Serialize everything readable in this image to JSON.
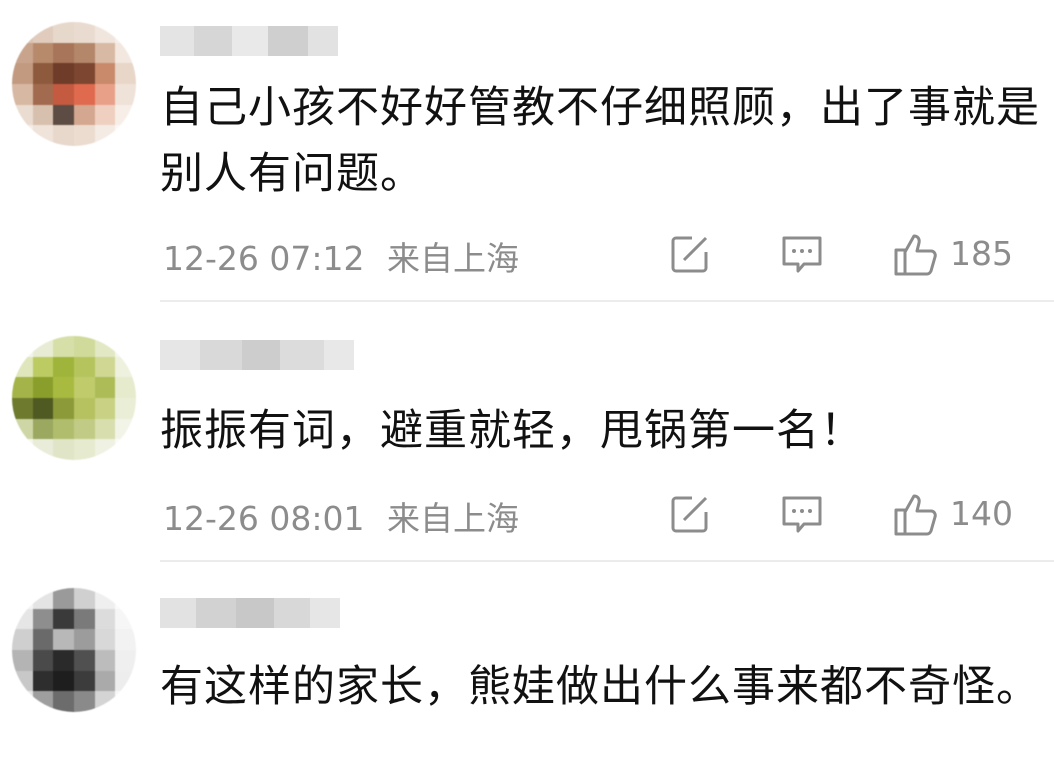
{
  "comments": [
    {
      "text": "自己小孩不好好管教不仔细照顾，出了事就是别人有问题。",
      "time": "12-26 07:12",
      "location": "来自上海",
      "likes": "185"
    },
    {
      "text": "振振有词，避重就轻，甩锅第一名！",
      "time": "12-26 08:01",
      "location": "来自上海",
      "likes": "140"
    },
    {
      "text": "有这样的家长，熊娃做出什么事来都不奇怪。"
    }
  ],
  "icons": {
    "share": "share-icon",
    "reply": "comment-icon",
    "like": "thumbs-up-icon"
  },
  "colors": {
    "text": "#111111",
    "meta": "#8c8c8c",
    "divider": "#ececec"
  }
}
